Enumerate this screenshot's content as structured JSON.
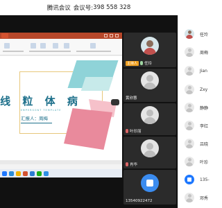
{
  "titlebar": {
    "app": "腾讯会议",
    "meeting_label": "会议号:",
    "meeting_id": "398 558 328"
  },
  "slide": {
    "title": "线 粒 体 病",
    "subtitle": "EMPERSONT TEMPLATE",
    "presenter": "汇报人：周梅"
  },
  "video_tiles": [
    {
      "name": "任玲",
      "host_tag": "主持人"
    },
    {
      "name": "黄欣蓉"
    },
    {
      "name": "叶珍丽"
    },
    {
      "name": "肖华"
    },
    {
      "name": "13540922472"
    }
  ],
  "participants": [
    {
      "name": "任玲"
    },
    {
      "name": "周梅"
    },
    {
      "name": "Jian"
    },
    {
      "name": "Zxy"
    },
    {
      "name": "静静"
    },
    {
      "name": "李红"
    },
    {
      "name": "吕晓"
    },
    {
      "name": "叶珍"
    },
    {
      "name": "135-"
    },
    {
      "name": "邓秀"
    }
  ],
  "colors": {
    "host_tag": "#f0a020",
    "phone": "#1e78ff",
    "slide_title": "#1c6f8a"
  }
}
